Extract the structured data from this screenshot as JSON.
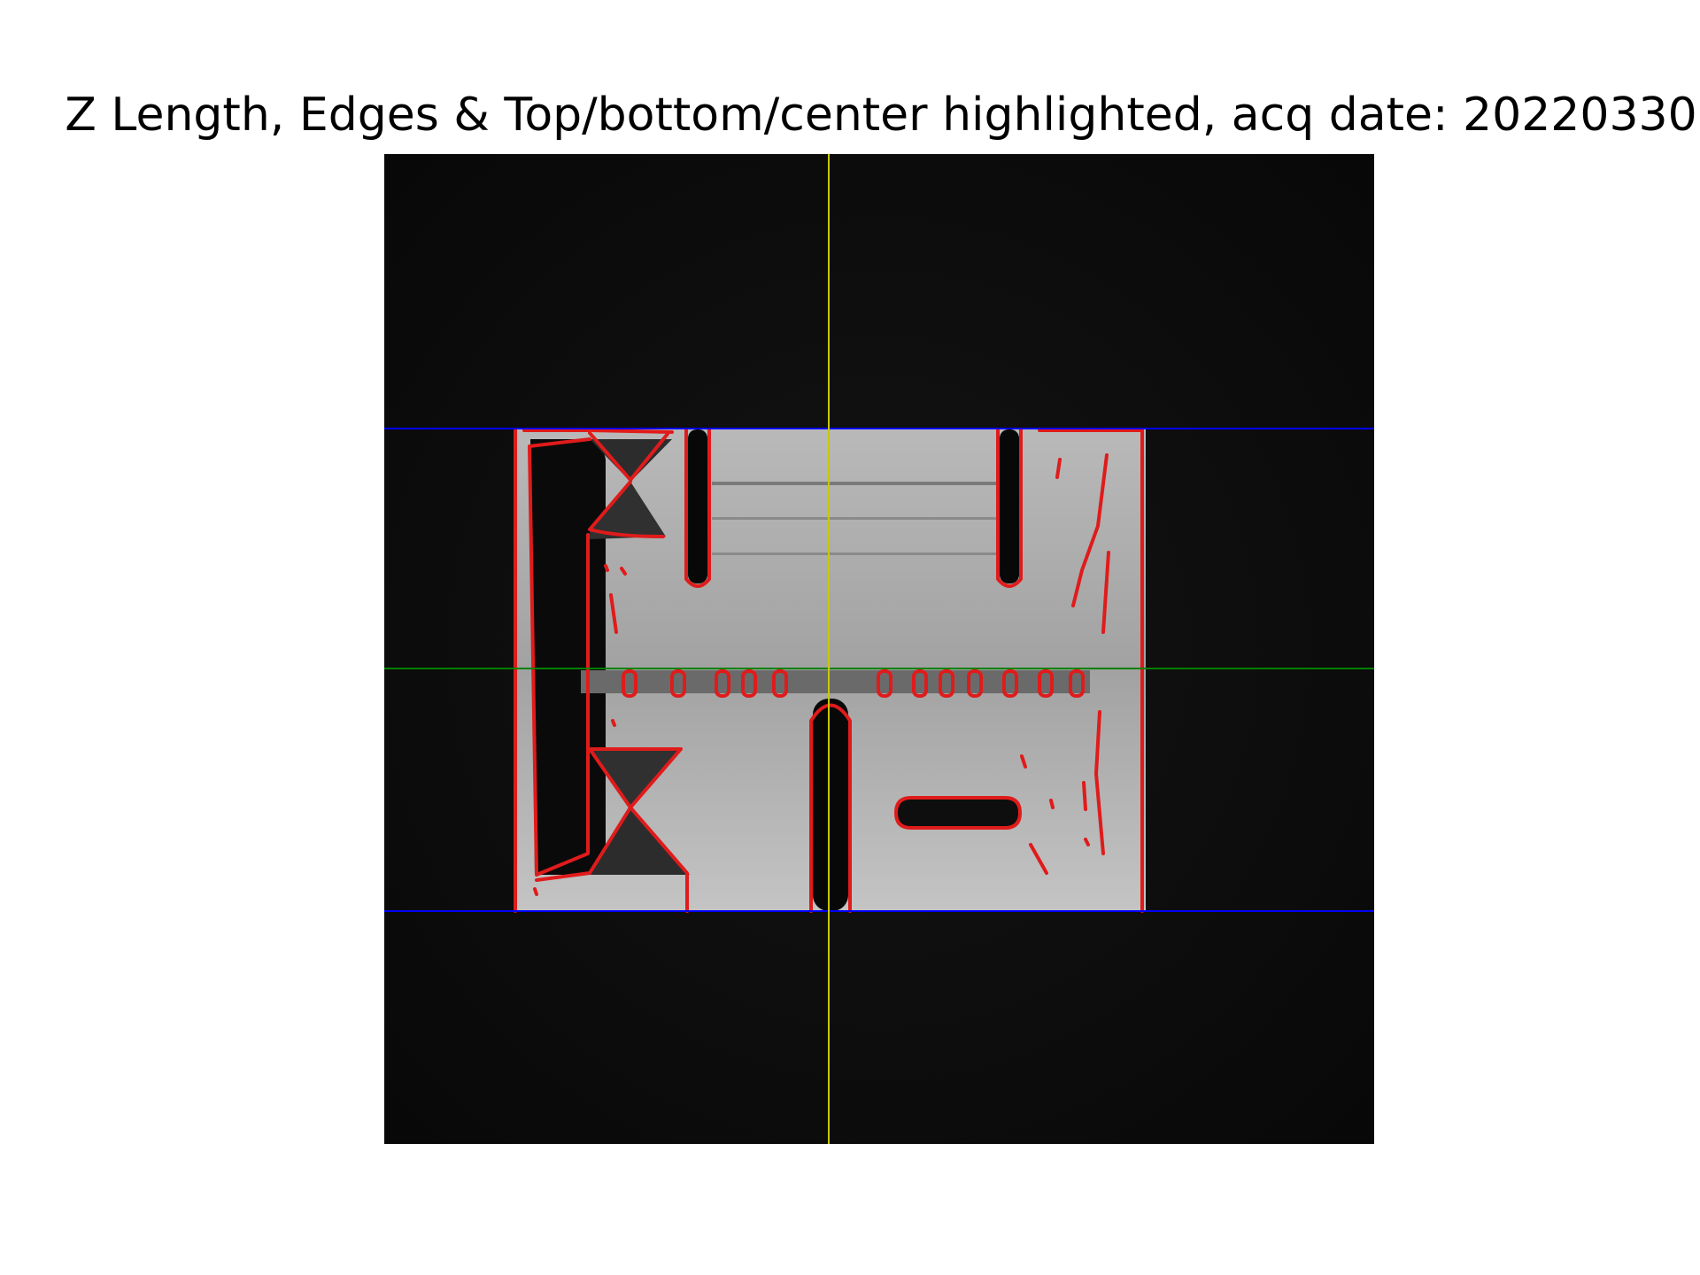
{
  "figure": {
    "title": "Z Length, Edges & Top/bottom/center highlighted, acq date: 20220330"
  },
  "colors": {
    "background": "#0b0b0b",
    "edge": "#e01b1b",
    "top_bottom_line": "#0000ff",
    "center_line": "#008000",
    "vertical_line": "#c8c800"
  },
  "icons": [
    "mri-phantom-slice"
  ]
}
